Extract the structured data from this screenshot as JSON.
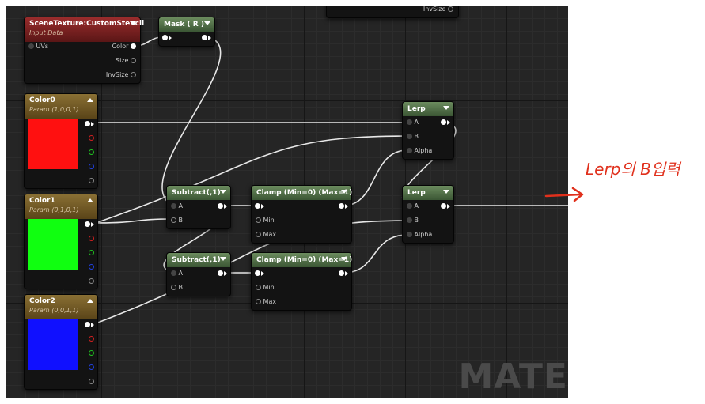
{
  "colors": {
    "canvas_bg": "#252525",
    "annotation": "#e0301c",
    "wire": "#e8e8e8"
  },
  "top_partial_node": {
    "pin": "InvSize"
  },
  "nodes": {
    "scene_texture": {
      "title": "SceneTexture:CustomStencil",
      "subtitle": "Input Data",
      "pins": [
        "UVs",
        "Color",
        "Size",
        "InvSize"
      ]
    },
    "mask": {
      "title": "Mask ( R )"
    },
    "color0": {
      "title": "Color0",
      "subtitle": "Param (1,0,0,1)",
      "swatch": "#ff1010"
    },
    "color1": {
      "title": "Color1",
      "subtitle": "Param (0,1,0,1)",
      "swatch": "#10ff10"
    },
    "color2": {
      "title": "Color2",
      "subtitle": "Param (0,0,1,1)",
      "swatch": "#1010ff"
    },
    "subtract1": {
      "title": "Subtract(,1)",
      "pins": [
        "A",
        "B"
      ]
    },
    "subtract2": {
      "title": "Subtract(,1)",
      "pins": [
        "A",
        "B"
      ]
    },
    "clamp1": {
      "title": "Clamp (Min=0) (Max=1)",
      "pins": [
        "Min",
        "Max"
      ]
    },
    "clamp2": {
      "title": "Clamp (Min=0) (Max=1)",
      "pins": [
        "Min",
        "Max"
      ]
    },
    "lerp1": {
      "title": "Lerp",
      "pins": [
        "A",
        "B",
        "Alpha"
      ]
    },
    "lerp2": {
      "title": "Lerp",
      "pins": [
        "A",
        "B",
        "Alpha"
      ]
    }
  },
  "watermark": "MATE",
  "annotation": {
    "text": "Lerp의 B입력"
  }
}
